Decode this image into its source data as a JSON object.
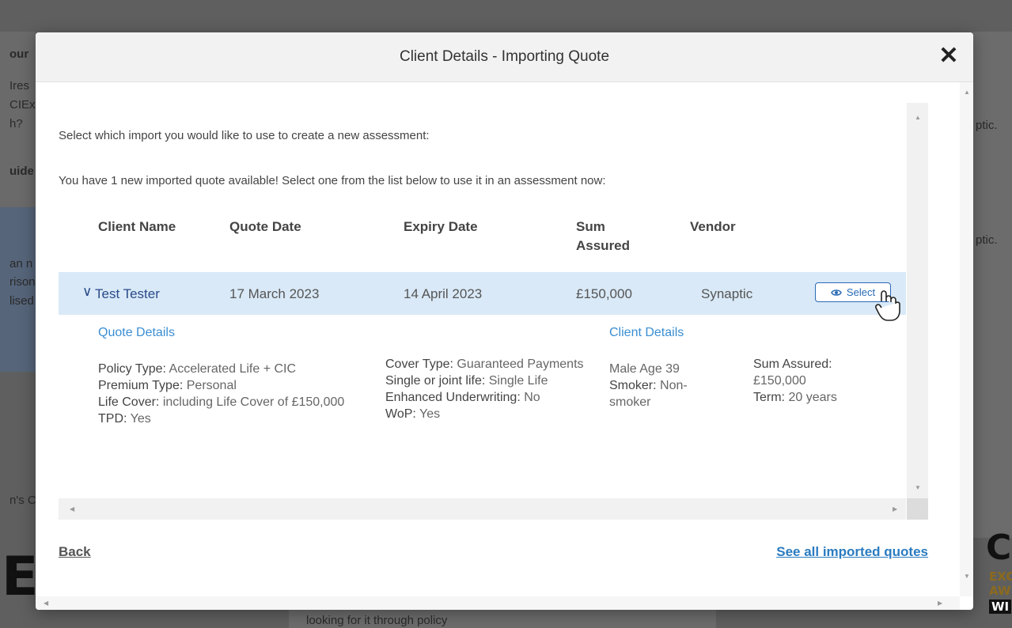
{
  "background": {
    "fragments": [
      "our",
      "Ires",
      "CIEx",
      "h?",
      "uide",
      "an n",
      "rison",
      "lised",
      "n's C",
      "ptic.",
      "ptic.",
      "looking for it through policy",
      "ER",
      "CO",
      "EXC",
      "AW",
      "WI"
    ]
  },
  "modal": {
    "title": "Client Details - Importing Quote",
    "close_label": "✕",
    "intro_line1": "Select which import you would like to use to create a new assessment:",
    "intro_line2": "You have 1 new imported quote available! Select one from the list below to use it in an assessment now:",
    "table": {
      "headers": [
        "Client Name",
        "Quote Date",
        "Expiry Date",
        "Sum\nAssured",
        "Vendor"
      ],
      "row": {
        "chevron": "∨",
        "client_name": "Test Tester",
        "quote_date": "17 March 2023",
        "expiry_date": "14 April 2023",
        "sum_assured": "£150,000",
        "vendor": "Synaptic",
        "select_label": "Select"
      }
    },
    "quote_details": {
      "title": "Quote Details",
      "col1": [
        {
          "label": "Policy Type:",
          "value": "Accelerated Life + CIC"
        },
        {
          "label": "Premium Type:",
          "value": "Personal"
        },
        {
          "label": "Life Cover:",
          "value": "including Life Cover of £150,000"
        },
        {
          "label": "TPD:",
          "value": "Yes"
        }
      ],
      "col2": [
        {
          "label": "Cover Type:",
          "value": "Guaranteed Payments"
        },
        {
          "label": "Single or joint life:",
          "value": "Single Life"
        },
        {
          "label": "Enhanced Underwriting:",
          "value": "No"
        },
        {
          "label": "WoP:",
          "value": "Yes"
        }
      ]
    },
    "client_details": {
      "title": "Client Details",
      "col1_line1": "Male Age 39",
      "smoker_label": "Smoker:",
      "smoker_value": "Non-smoker",
      "sum_label": "Sum Assured:",
      "sum_value": "£150,000",
      "term_label": "Term:",
      "term_value": "20 years"
    },
    "back_label": "Back",
    "see_all_label": "See all imported quotes"
  }
}
